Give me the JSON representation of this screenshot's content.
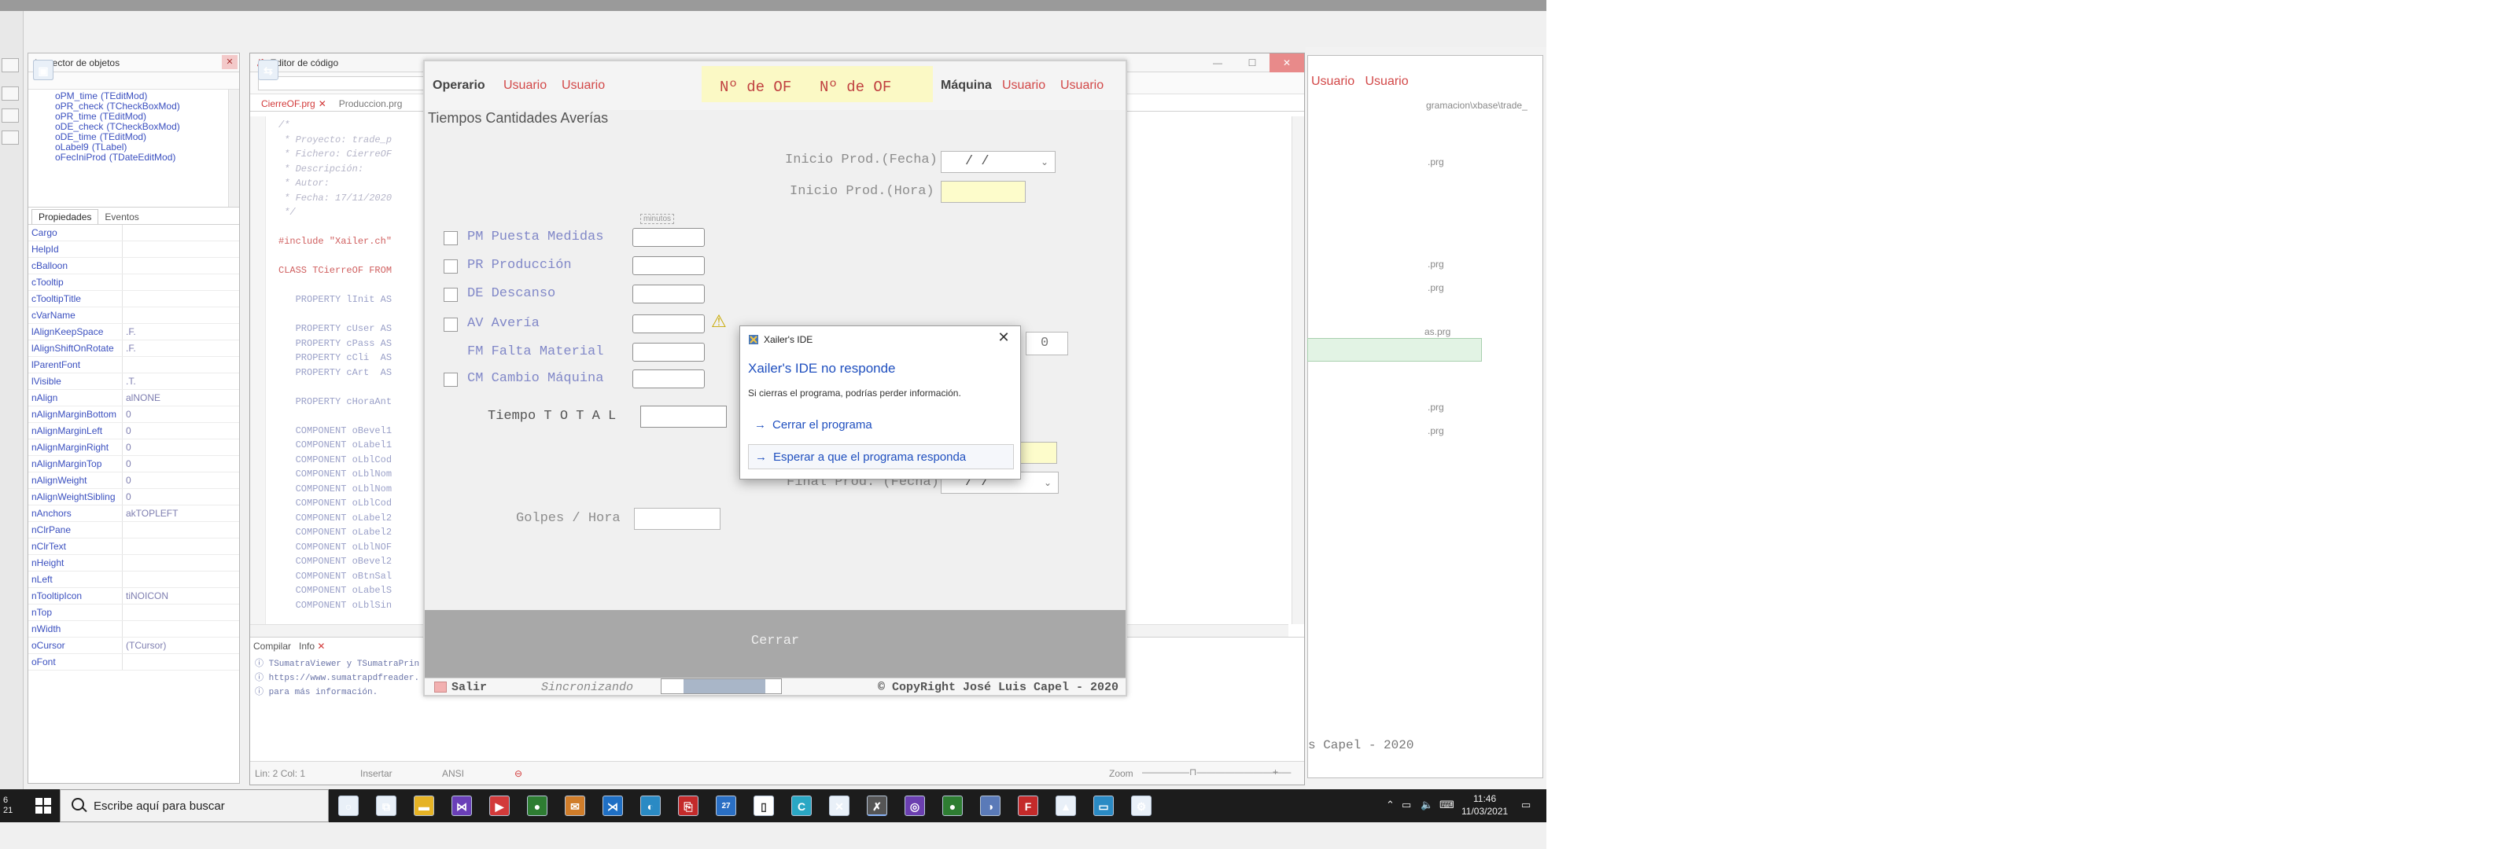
{
  "inspector": {
    "title": "Inspector de objetos",
    "objects": [
      {
        "name": "oPM_time",
        "type": "(TEditMod)"
      },
      {
        "name": "oPR_check",
        "type": "(TCheckBoxMod)"
      },
      {
        "name": "oPR_time",
        "type": "(TEditMod)"
      },
      {
        "name": "oDE_check",
        "type": "(TCheckBoxMod)"
      },
      {
        "name": "oDE_time",
        "type": "(TEditMod)"
      },
      {
        "name": "oLabel9",
        "type": "(TLabel)"
      },
      {
        "name": "oFecIniProd",
        "type": "(TDateEditMod)"
      }
    ],
    "tabs": [
      "Propiedades",
      "Eventos"
    ],
    "properties": [
      {
        "name": "Cargo",
        "value": ""
      },
      {
        "name": "HelpId",
        "value": ""
      },
      {
        "name": "cBalloon",
        "value": ""
      },
      {
        "name": "cTooltip",
        "value": ""
      },
      {
        "name": "cTooltipTitle",
        "value": ""
      },
      {
        "name": "cVarName",
        "value": ""
      },
      {
        "name": "lAlignKeepSpace",
        "value": ".F."
      },
      {
        "name": "lAlignShiftOnRotate",
        "value": ".F."
      },
      {
        "name": "lParentFont",
        "value": ""
      },
      {
        "name": "lVisible",
        "value": ".T."
      },
      {
        "name": "nAlign",
        "value": "alNONE"
      },
      {
        "name": "nAlignMarginBottom",
        "value": "0"
      },
      {
        "name": "nAlignMarginLeft",
        "value": "0"
      },
      {
        "name": "nAlignMarginRight",
        "value": "0"
      },
      {
        "name": "nAlignMarginTop",
        "value": "0"
      },
      {
        "name": "nAlignWeight",
        "value": "0"
      },
      {
        "name": "nAlignWeightSibling",
        "value": "0"
      },
      {
        "name": "nAnchors",
        "value": "akTOPLEFT"
      },
      {
        "name": "nClrPane",
        "value": ""
      },
      {
        "name": "nClrText",
        "value": ""
      },
      {
        "name": "nHeight",
        "value": ""
      },
      {
        "name": "nLeft",
        "value": ""
      },
      {
        "name": "nTooltipIcon",
        "value": "tiNOICON"
      },
      {
        "name": "nTop",
        "value": ""
      },
      {
        "name": "nWidth",
        "value": ""
      },
      {
        "name": "oCursor",
        "value": "(TCursor)"
      },
      {
        "name": "oFont",
        "value": ""
      }
    ]
  },
  "editor": {
    "title": "Editor de código",
    "file_tabs": [
      {
        "label": "CierreOF.prg",
        "active": true
      },
      {
        "label": "Produccion.prg",
        "active": false
      }
    ],
    "code_lines": [
      {
        "text": "/*",
        "kind": "cm"
      },
      {
        "text": " * Proyecto: trade_p",
        "kind": "cm"
      },
      {
        "text": " * Fichero: CierreOF",
        "kind": "cm"
      },
      {
        "text": " * Descripción:",
        "kind": "cm"
      },
      {
        "text": " * Autor:",
        "kind": "cm"
      },
      {
        "text": " * Fecha: 17/11/2020",
        "kind": "cm"
      },
      {
        "text": " */",
        "kind": "cm"
      },
      {
        "text": "",
        "kind": "kw"
      },
      {
        "text": "#include \"Xailer.ch\"",
        "kind": "red"
      },
      {
        "text": "",
        "kind": "kw"
      },
      {
        "text": "CLASS TCierreOF FROM",
        "kind": "red"
      },
      {
        "text": "",
        "kind": "kw"
      },
      {
        "text": "   PROPERTY lInit AS",
        "kind": "kw"
      },
      {
        "text": "",
        "kind": "kw"
      },
      {
        "text": "   PROPERTY cUser AS",
        "kind": "kw"
      },
      {
        "text": "   PROPERTY cPass AS",
        "kind": "kw"
      },
      {
        "text": "   PROPERTY cCli  AS",
        "kind": "kw"
      },
      {
        "text": "   PROPERTY cArt  AS",
        "kind": "kw"
      },
      {
        "text": "",
        "kind": "kw"
      },
      {
        "text": "   PROPERTY cHoraAnt",
        "kind": "kw"
      },
      {
        "text": "",
        "kind": "kw"
      },
      {
        "text": "   COMPONENT oBevel1",
        "kind": "kw"
      },
      {
        "text": "   COMPONENT oLabel1",
        "kind": "kw"
      },
      {
        "text": "   COMPONENT oLblCod",
        "kind": "kw"
      },
      {
        "text": "   COMPONENT oLblNom",
        "kind": "kw"
      },
      {
        "text": "   COMPONENT oLblNom",
        "kind": "kw"
      },
      {
        "text": "   COMPONENT oLblCod",
        "kind": "kw"
      },
      {
        "text": "   COMPONENT oLabel2",
        "kind": "kw"
      },
      {
        "text": "   COMPONENT oLabel2",
        "kind": "kw"
      },
      {
        "text": "   COMPONENT oLblNOF",
        "kind": "kw"
      },
      {
        "text": "   COMPONENT oBevel2",
        "kind": "kw"
      },
      {
        "text": "   COMPONENT oBtnSal",
        "kind": "kw"
      },
      {
        "text": "   COMPONENT oLabelS",
        "kind": "kw"
      },
      {
        "text": "   COMPONENT oLblSin",
        "kind": "kw"
      }
    ],
    "compile_tabs": [
      "Compilar",
      "Info"
    ],
    "compile_lines": [
      "TSumatraViewer y TSumatraPrin",
      "https://www.sumatrapdfreader.",
      "para más información."
    ],
    "status": {
      "position": "Lin: 2   Col: 1",
      "mode": "Insertar",
      "encoding": "ANSI",
      "zoom_label": "Zoom"
    }
  },
  "right_panel": {
    "header_labels": [
      "Usuario",
      "Usuario"
    ],
    "path_text": "gramacion\\xbase\\trade_",
    "file_lines": [
      ".prg",
      ".prg",
      ".prg",
      "as.prg",
      ".prg",
      ".prg"
    ],
    "footer_text": "s Capel - 2020"
  },
  "form": {
    "header": {
      "operario": "Operario",
      "usuario1": "Usuario",
      "usuario2": "Usuario",
      "nof1": "Nº de OF",
      "nof2": "Nº de OF",
      "maquina": "Máquina",
      "usuario3": "Usuario",
      "usuario4": "Usuario"
    },
    "tabs_text": "Tiempos Cantidades Averías",
    "inicio_fecha_label": "Inicio Prod.(Fecha)",
    "inicio_fecha_value": "/  /",
    "inicio_hora_label": "Inicio Prod.(Hora)",
    "minutos_label": "minutos",
    "checks": [
      {
        "code": "PM",
        "label": "Puesta Medidas",
        "has_check": true
      },
      {
        "code": "PR",
        "label": "Producción",
        "has_check": true
      },
      {
        "code": "DE",
        "label": "Descanso",
        "has_check": true
      },
      {
        "code": "AV",
        "label": "Avería",
        "has_check": true
      },
      {
        "code": "FM",
        "label": "Falta Material",
        "has_check": false
      },
      {
        "code": "CM",
        "label": "Cambio Máquina",
        "has_check": true
      }
    ],
    "total_label": "Tiempo T O T A L",
    "zero_value": "0",
    "final_fecha_label": "Final Prod. (Fecha)",
    "final_fecha_value": "/  /",
    "golpes_label": "Golpes / Hora",
    "close_button": "Cerrar",
    "footer": {
      "salir": "Salir",
      "sync": "Sincronizando",
      "copyright": "© CopyRight José Luis Capel - 2020"
    }
  },
  "dialog": {
    "title": "Xailer's IDE",
    "heading": "Xailer's IDE no responde",
    "message": "Si cierras el programa, podrías perder información.",
    "option_close": "Cerrar el programa",
    "option_wait": "Esperar a que el programa responda"
  },
  "taskbar": {
    "left_text_1": "6",
    "left_text_2": "21",
    "search_placeholder": "Escribe aquí para buscar",
    "time": "11:46",
    "date": "11/03/2021",
    "badge": "27"
  },
  "colors": {
    "accent_blue": "#1f4fbf",
    "label_red": "#d24848",
    "highlight_yellow": "#fbf9c5",
    "taskbar": "#1c1c1c"
  }
}
